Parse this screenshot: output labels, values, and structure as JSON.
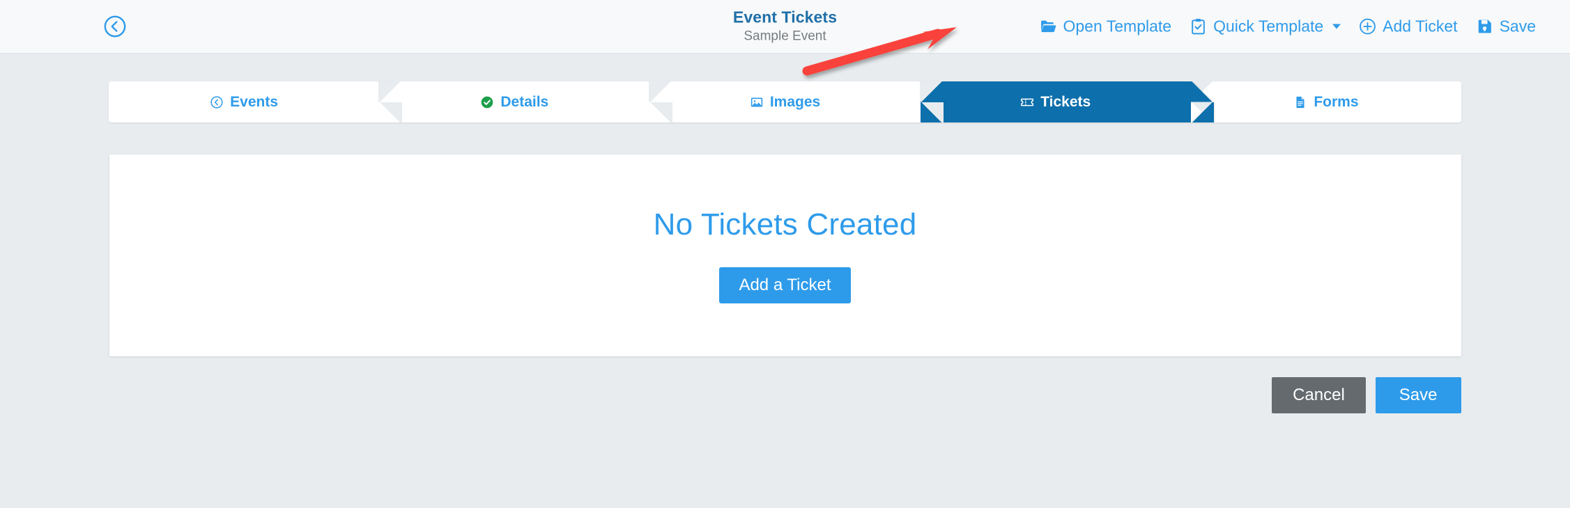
{
  "header": {
    "back_icon": "circle-chevron-left-icon",
    "title": "Event Tickets",
    "subtitle": "Sample Event",
    "actions": [
      {
        "label": "Open Template",
        "icon": "folder-open-icon",
        "caret": false
      },
      {
        "label": "Quick Template",
        "icon": "clipboard-check-icon",
        "caret": true
      },
      {
        "label": "Add Ticket",
        "icon": "plus-circle-icon",
        "caret": false
      },
      {
        "label": "Save",
        "icon": "floppy-disk-icon",
        "caret": false
      }
    ]
  },
  "wizard": {
    "steps": [
      {
        "label": "Events",
        "icon": "circle-chevron-left-icon",
        "state": "link"
      },
      {
        "label": "Details",
        "icon": "circle-check-icon",
        "state": "completed"
      },
      {
        "label": "Images",
        "icon": "image-icon",
        "state": "link"
      },
      {
        "label": "Tickets",
        "icon": "ticket-icon",
        "state": "active"
      },
      {
        "label": "Forms",
        "icon": "file-lines-icon",
        "state": "link"
      }
    ]
  },
  "main": {
    "empty_title": "No Tickets Created",
    "add_ticket_label": "Add a Ticket"
  },
  "footer": {
    "cancel_label": "Cancel",
    "save_label": "Save"
  },
  "annotation": {
    "type": "arrow",
    "points_to": "Open Template",
    "color": "#f8423a"
  },
  "colors": {
    "page_background": "#e8ecef",
    "header_background": "#f8f9fa",
    "accent_blue": "#2e9bea",
    "active_step_blue": "#0d6fab",
    "title_blue": "#1f6fa8",
    "completed_green": "#1e9e4a",
    "cancel_gray": "#646a6e",
    "annotation_red": "#f8423a"
  }
}
